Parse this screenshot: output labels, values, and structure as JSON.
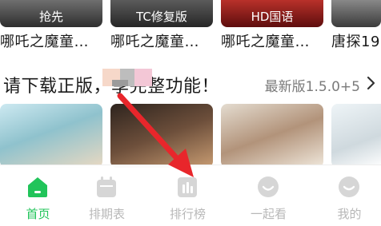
{
  "top_cards": [
    {
      "tag": "抢先",
      "title": "哪吒之魔童…",
      "colors": [
        "#3a3a3a",
        "#6f6f6f"
      ]
    },
    {
      "tag": "TC修复版",
      "title": "哪吒之魔童…",
      "colors": [
        "#2b2b2b",
        "#5b5b5b"
      ]
    },
    {
      "tag": "HD国语",
      "title": "哪吒之魔童…",
      "colors": [
        "#6b0f0f",
        "#b8312a"
      ]
    },
    {
      "tag": "",
      "title": "唐探19",
      "colors": [
        "#444444",
        "#888888"
      ]
    }
  ],
  "banner": {
    "text": "请下载正版，享完整功能！",
    "version": "最新版1.5.0+5",
    "chevron_icon": "chevron-right-icon"
  },
  "posters": [
    {
      "name": "poster-1",
      "colors": [
        "#bfe3ee",
        "#7fb7c4",
        "#e9d9c2"
      ]
    },
    {
      "name": "poster-2",
      "colors": [
        "#3a2a22",
        "#7a5a44",
        "#c89c72"
      ]
    },
    {
      "name": "poster-3",
      "colors": [
        "#d8cfc2",
        "#a88a70",
        "#f0e8dc"
      ]
    },
    {
      "name": "poster-4",
      "colors": [
        "#e6eef2",
        "#c9d4da",
        "#ffffff"
      ]
    }
  ],
  "nav": {
    "items": [
      {
        "label": "首页",
        "icon": "home-icon",
        "active": true
      },
      {
        "label": "排期表",
        "icon": "calendar-icon",
        "active": false
      },
      {
        "label": "排行榜",
        "icon": "ranking-icon",
        "active": false
      },
      {
        "label": "一起看",
        "icon": "watch-together-icon",
        "active": false
      },
      {
        "label": "我的",
        "icon": "profile-icon",
        "active": false
      }
    ]
  },
  "colors": {
    "accent": "#21c45a",
    "inactive": "#b8b8b8",
    "annotation_arrow": "#e8262b"
  }
}
